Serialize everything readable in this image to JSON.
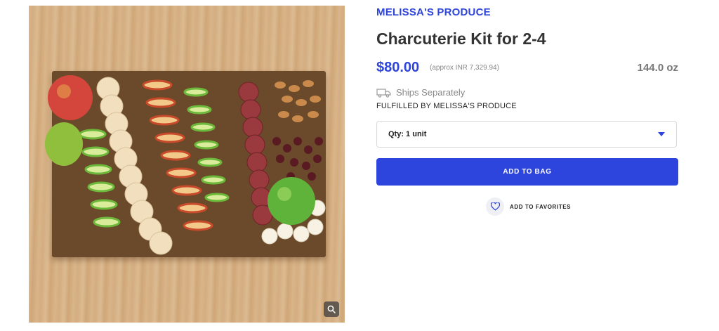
{
  "product": {
    "vendor": "MELISSA'S PRODUCE",
    "title": "Charcuterie Kit for 2-4",
    "price": "$80.00",
    "approx_price": "(approx INR 7,329.94)",
    "weight": "144.0 oz",
    "ships_text": "Ships Separately",
    "fulfilled_text": "FULFILLED BY MELISSA'S PRODUCE"
  },
  "quantity": {
    "selected": "Qty: 1 unit"
  },
  "actions": {
    "add_to_bag": "ADD TO BAG",
    "add_to_favorites": "ADD TO FAVORITES"
  },
  "icons": {
    "zoom": "magnifier-icon",
    "shipping": "truck-icon",
    "favorite": "heart-icon",
    "dropdown": "caret-down-icon"
  },
  "colors": {
    "accent": "#2f45d8",
    "button": "#2d44dd"
  }
}
